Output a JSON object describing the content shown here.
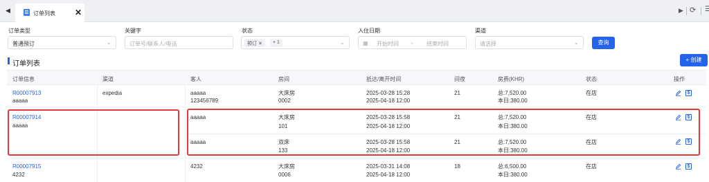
{
  "tab": {
    "label": "订单列表"
  },
  "filters": {
    "order_type": {
      "label": "订单类型",
      "value": "普通预订"
    },
    "keyword": {
      "label": "关键字",
      "placeholder": "订单号/联系人/电话"
    },
    "status": {
      "label": "状态",
      "tag": "预订",
      "extra": "+ 1"
    },
    "checkin": {
      "label": "入住日期",
      "start_placeholder": "开始时间",
      "separator": "-",
      "end_placeholder": "结束时间"
    },
    "channel": {
      "label": "渠道",
      "placeholder": "请选择"
    },
    "search_label": "查询"
  },
  "list": {
    "title": "订单列表",
    "create_label": "+ 创建"
  },
  "table": {
    "headers": [
      "订单信息",
      "渠道",
      "客人",
      "房间",
      "抵达/离开时间",
      "间夜",
      "房费(KHR)",
      "状态",
      "操作"
    ],
    "rows": [
      {
        "order_no": "R00007913",
        "order_name": "aaaaa",
        "channel": "expedia",
        "guest": "aaaaa",
        "guest_phone": "123456789",
        "room_type": "大床房",
        "room_no": "0002",
        "arrive": "2025-03-28 15:28",
        "leave": "2025-04-18 12:00",
        "nights": "21",
        "total": "总:7,520.00",
        "daily": "本日:380.00",
        "status": "在店"
      },
      {
        "order_no": "R00007914",
        "order_name": "aaaaa",
        "channel": "",
        "guest": "aaaaa",
        "guest_phone": "",
        "room_type": "大床房",
        "room_no": "101",
        "arrive": "2025-03-28 15:58",
        "leave": "2025-04-18 12:00",
        "nights": "21",
        "total": "总:7,520.00",
        "daily": "本日:380.00",
        "status": "在店"
      },
      {
        "order_no": "",
        "order_name": "",
        "channel": "",
        "guest": "aaaaa",
        "guest_phone": "",
        "room_type": "双床",
        "room_no": "133",
        "arrive": "2025-03-28 15:58",
        "leave": "2025-04-18 12:00",
        "nights": "21",
        "total": "总:7,520.00",
        "daily": "本日:380.00",
        "status": "在店"
      },
      {
        "order_no": "R00007915",
        "order_name": "4232",
        "channel": "",
        "guest": "4232",
        "guest_phone": "",
        "room_type": "大床房",
        "room_no": "0006",
        "arrive": "2025-03-31 14:08",
        "leave": "2025-04-18 12:00",
        "nights": "18",
        "total": "总:6,500.00",
        "daily": "本日:380.00",
        "status": "在店"
      }
    ]
  },
  "colors": {
    "primary": "#2563eb",
    "highlight": "#e5393c"
  }
}
